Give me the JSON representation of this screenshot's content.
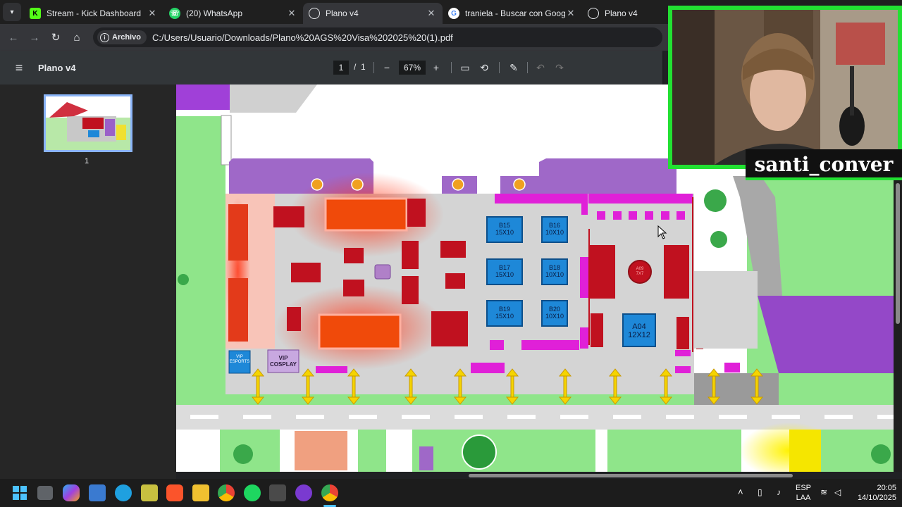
{
  "tabs": [
    {
      "title": "Stream - Kick Dashboard",
      "icon": "kick-icon",
      "active": false
    },
    {
      "title": "(20) WhatsApp",
      "icon": "whatsapp-icon",
      "active": false
    },
    {
      "title": "Plano v4",
      "icon": "pdf-globe-icon",
      "active": true
    },
    {
      "title": "traniela - Buscar con Google",
      "icon": "google-icon",
      "active": false
    },
    {
      "title": "Plano v4",
      "icon": "pdf-globe-icon",
      "active": false
    }
  ],
  "omnibox": {
    "chip_label": "Archivo",
    "url": "C:/Users/Usuario/Downloads/Plano%20AGS%20Visa%202025%20(1).pdf"
  },
  "pdf": {
    "title": "Plano v4",
    "page_current": "1",
    "page_sep": "/",
    "page_total": "1",
    "zoom": "67%",
    "thumb_number": "1"
  },
  "map": {
    "booths_blue": [
      {
        "code": "B15",
        "size": "15X10"
      },
      {
        "code": "B16",
        "size": "10X10"
      },
      {
        "code": "B17",
        "size": "15X10"
      },
      {
        "code": "B18",
        "size": "10X10"
      },
      {
        "code": "B19",
        "size": "15X10"
      },
      {
        "code": "B20",
        "size": "10X10"
      },
      {
        "code": "A04",
        "size": "12X12"
      }
    ],
    "vip_esports": "VIP ESPORTS",
    "vip_cosplay_1": "VIP",
    "vip_cosplay_2": "COSPLAY",
    "round_booth": "A09 7X7"
  },
  "webcam": {
    "name": "santi_conver"
  },
  "taskbar": {
    "lang_1": "ESP",
    "lang_2": "LAA",
    "time": "20:05",
    "date": "14/10/2025"
  },
  "colors": {
    "accent": "#8ab4f8",
    "webcam_border": "#22e032",
    "booth_blue": "#1e88d8",
    "booth_red": "#c0111f",
    "booth_magenta": "#e020d8"
  }
}
